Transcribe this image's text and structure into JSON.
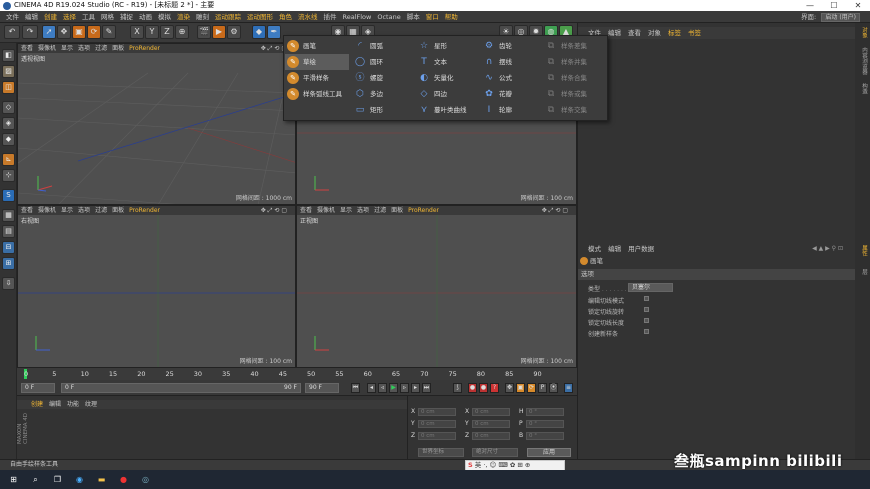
{
  "window": {
    "title": "CINEMA 4D R19.024 Studio (RC - R19) - [未标题 2 *] - 主要",
    "minimize": "—",
    "maximize": "☐",
    "close": "✕"
  },
  "menubar": {
    "items": [
      "文件",
      "编辑",
      "创建",
      "选择",
      "工具",
      "网格",
      "捕捉",
      "动画",
      "模拟",
      "渲染",
      "雕刻",
      "运动跟踪",
      "运动图形",
      "角色",
      "流水线",
      "插件",
      "RealFlow",
      "Octane",
      "脚本",
      "窗口",
      "帮助"
    ],
    "highlighted": [
      "创建",
      "选择",
      "渲染",
      "运动跟踪",
      "运动图形",
      "角色",
      "流水线",
      "窗口",
      "帮助"
    ],
    "layout_label": "界面:",
    "layout_value": "启动 (用户)"
  },
  "viewports": {
    "top_left": {
      "menu": [
        "查看",
        "摄像机",
        "显示",
        "选项",
        "过滤",
        "面板",
        "ProRender"
      ],
      "title": "透视视图",
      "grid": ""
    },
    "top_right": {
      "menu": [
        "查看",
        "摄像机",
        "显示",
        "选项",
        "过滤",
        "面板",
        "ProRender"
      ],
      "title": "",
      "grid": "网格间距 : 100 cm"
    },
    "bottom_left": {
      "menu": [
        "查看",
        "摄像机",
        "显示",
        "选项",
        "过滤",
        "面板",
        "ProRender"
      ],
      "title": "右视图",
      "grid": "网格间距 : 100 cm"
    },
    "bottom_right": {
      "menu": [
        "查看",
        "摄像机",
        "显示",
        "选项",
        "过滤",
        "面板",
        "ProRender"
      ],
      "title": "正视图",
      "grid": "网格间距 : 100 cm"
    },
    "top_left_grid": "网格间距 : 1000 cm",
    "nav_icons": "✥ ⤢ ⟲ ▢"
  },
  "spline_menu": {
    "col1": [
      {
        "label": "画笔",
        "icon": "pen-icon",
        "selected": false
      },
      {
        "label": "草绘",
        "icon": "sketch-icon",
        "selected": true
      },
      {
        "label": "平滑样条",
        "icon": "smooth-spline-icon",
        "selected": false
      },
      {
        "label": "样条弧线工具",
        "icon": "spline-arc-icon",
        "selected": false
      }
    ],
    "col2": [
      {
        "label": "圆弧",
        "glyph": "◜"
      },
      {
        "label": "圆环",
        "glyph": "◯"
      },
      {
        "label": "螺旋",
        "glyph": "ⓢ"
      },
      {
        "label": "多边",
        "glyph": "⬡"
      },
      {
        "label": "矩形",
        "glyph": "▭"
      }
    ],
    "col3": [
      {
        "label": "星形",
        "glyph": "☆"
      },
      {
        "label": "文本",
        "glyph": "T"
      },
      {
        "label": "矢量化",
        "glyph": "◐"
      },
      {
        "label": "四边",
        "glyph": "◇"
      },
      {
        "label": "蔓叶类曲线",
        "glyph": "⋎"
      }
    ],
    "col4": [
      {
        "label": "齿轮",
        "glyph": "⚙"
      },
      {
        "label": "摆线",
        "glyph": "∩"
      },
      {
        "label": "公式",
        "glyph": "∿"
      },
      {
        "label": "花瓣",
        "glyph": "✿"
      },
      {
        "label": "轮廓",
        "glyph": "I"
      }
    ],
    "col5": [
      {
        "label": "样条差集"
      },
      {
        "label": "样条并集"
      },
      {
        "label": "样条合集"
      },
      {
        "label": "样条或集"
      },
      {
        "label": "样条交集"
      }
    ]
  },
  "object_panel": {
    "tabs": [
      "文件",
      "编辑",
      "查看",
      "对象",
      "标签",
      "书签"
    ],
    "highlighted": [
      "标签",
      "书签"
    ]
  },
  "attributes": {
    "tabs": [
      "模式",
      "编辑",
      "用户数据"
    ],
    "object": "画笔",
    "section": "选项",
    "type_label": "类型",
    "type_value": "贝塞尔",
    "options": [
      "编辑切线模式",
      "锁定切线旋转",
      "锁定切线长度",
      "创建新样条"
    ]
  },
  "right_strip": [
    "对象",
    "内容浏览器",
    "构造",
    "属性",
    "层"
  ],
  "timeline": {
    "ticks": [
      "0",
      "5",
      "10",
      "15",
      "20",
      "25",
      "30",
      "35",
      "40",
      "45",
      "50",
      "55",
      "60",
      "65",
      "70",
      "75",
      "80",
      "85",
      "90"
    ],
    "current_frame": 0
  },
  "transport": {
    "start": "0 F",
    "current": "0 F",
    "end": "90 F",
    "end2": "90 F",
    "range_start": "0 F"
  },
  "materials": {
    "tabs": [
      "创建",
      "编辑",
      "功能",
      "纹理"
    ],
    "highlighted": [
      "创建"
    ],
    "logo": "MAXON CINEMA 4D"
  },
  "coordinates": {
    "rows": [
      {
        "axis": "X",
        "pos": "0 cm",
        "axis2": "X",
        "size": "0 cm",
        "axis3": "H",
        "rot": "0 °"
      },
      {
        "axis": "Y",
        "pos": "0 cm",
        "axis2": "Y",
        "size": "0 cm",
        "axis3": "P",
        "rot": "0 °"
      },
      {
        "axis": "Z",
        "pos": "0 cm",
        "axis2": "Z",
        "size": "0 cm",
        "axis3": "B",
        "rot": "0 °"
      }
    ],
    "mode": "世界坐标",
    "scale": "绝对尺寸",
    "apply": "应用"
  },
  "status": "自由手绘样条工具",
  "ime": {
    "logo": "S",
    "text": "英 ·, ☺ ⌨ ✿ ⊞ ⊕"
  },
  "watermark": "叁瓶sampinn  bilibili",
  "colors": {
    "accent": "#f2b733",
    "bg": "#333333",
    "viewport": "#4f4f4f",
    "selection": "#3e7cc2"
  }
}
